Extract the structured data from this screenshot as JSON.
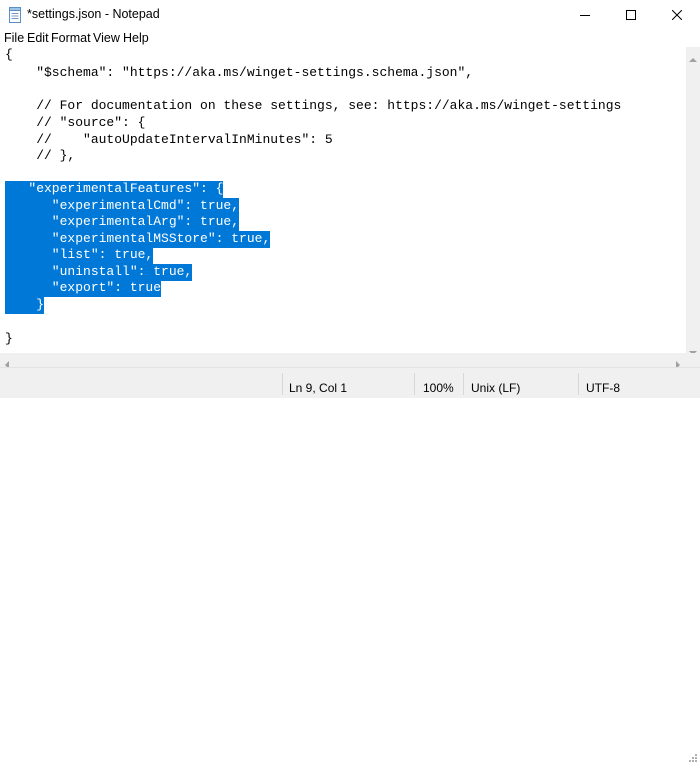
{
  "window": {
    "title": "*settings.json - Notepad"
  },
  "menu": {
    "file": "File",
    "edit": "Edit",
    "format": "Format",
    "view": "View",
    "help": "Help"
  },
  "editor": {
    "lines": [
      "{",
      "    \"$schema\": \"https://aka.ms/winget-settings.schema.json\",",
      "",
      "    // For documentation on these settings, see: https://aka.ms/winget-settings",
      "    // \"source\": {",
      "    //    \"autoUpdateIntervalInMinutes\": 5",
      "    // },",
      "",
      "   \"experimentalFeatures\": {",
      "      \"experimentalCmd\": true,",
      "      \"experimentalArg\": true,",
      "      \"experimentalMSStore\": true,",
      "      \"list\": true,",
      "      \"uninstall\": true,",
      "      \"export\": true",
      "    }",
      "",
      "}"
    ],
    "selected_lines": [
      8,
      9,
      10,
      11,
      12,
      13,
      14,
      15
    ],
    "selection_color": "#0078d7"
  },
  "status": {
    "position": "Ln 9, Col 1",
    "zoom": "100%",
    "line_ending": "Unix (LF)",
    "encoding": "UTF-8"
  },
  "icons": {
    "app": "notepad-icon",
    "minimize": "minimize-icon",
    "maximize": "maximize-icon",
    "close": "close-icon"
  }
}
